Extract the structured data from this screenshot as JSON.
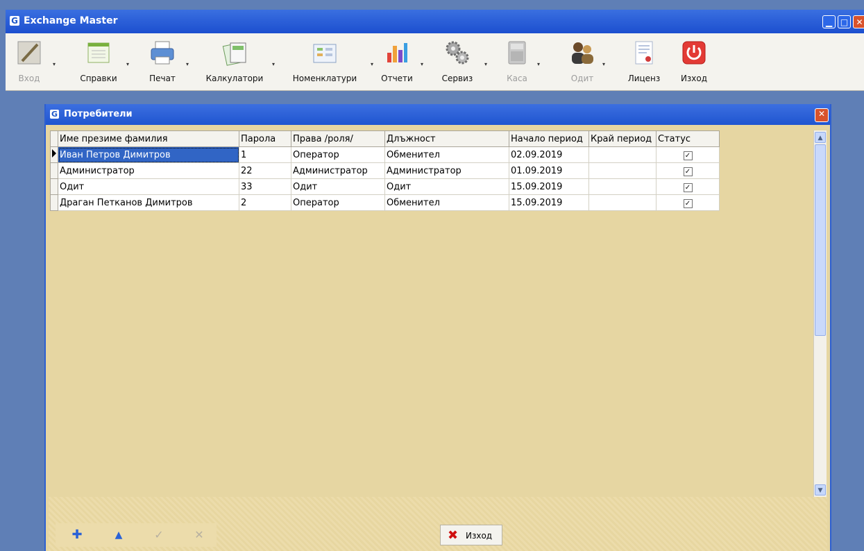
{
  "window": {
    "title": "Exchange Master",
    "icon_letter": "G"
  },
  "toolbar": {
    "items": [
      {
        "label": "Вход",
        "icon": "pencil-icon",
        "disabled": true
      },
      {
        "label": "Справки",
        "icon": "document-icon",
        "disabled": false
      },
      {
        "label": "Печат",
        "icon": "printer-icon",
        "disabled": false
      },
      {
        "label": "Калкулатори",
        "icon": "calculator-spreadsheet-icon",
        "disabled": false
      },
      {
        "label": "Номенклатури",
        "icon": "nomenclature-icon",
        "disabled": false
      },
      {
        "label": "Отчети",
        "icon": "reports-icon",
        "disabled": false
      },
      {
        "label": "Сервиз",
        "icon": "gears-icon",
        "disabled": false
      },
      {
        "label": "Каса",
        "icon": "cash-register-icon",
        "disabled": true
      },
      {
        "label": "Одит",
        "icon": "users-icon",
        "disabled": true
      },
      {
        "label": "Лиценз",
        "icon": "license-icon",
        "disabled": false
      },
      {
        "label": "Изход",
        "icon": "power-icon",
        "disabled": false
      }
    ]
  },
  "child": {
    "title": "Потребители",
    "icon_letter": "G",
    "columns": [
      "Име презиме фамилия",
      "Парола",
      "Права /роля/",
      "Длъжност",
      "Начало период",
      "Край период",
      "Статус"
    ],
    "rows": [
      {
        "name": "Иван Петров Димитров",
        "password": "1",
        "role": "Оператор",
        "position": "Обменител",
        "start": "02.09.2019",
        "end": "",
        "status": "✓"
      },
      {
        "name": "Администратор",
        "password": "22",
        "role": "Администратор",
        "position": "Администратор",
        "start": "01.09.2019",
        "end": "",
        "status": "✓"
      },
      {
        "name": "Одит",
        "password": "33",
        "role": "Одит",
        "position": "Одит",
        "start": "15.09.2019",
        "end": "",
        "status": "✓"
      },
      {
        "name": "Драган Петканов Димитров",
        "password": "2",
        "role": "Оператор",
        "position": "Обменител",
        "start": "15.09.2019",
        "end": "",
        "status": "✓"
      }
    ],
    "exit_label": "Изход"
  },
  "colors": {
    "titlebar": "#2357d6",
    "form_bg": "#e6d6a2",
    "selection": "#3165c5",
    "exit_red": "#cf1010"
  }
}
